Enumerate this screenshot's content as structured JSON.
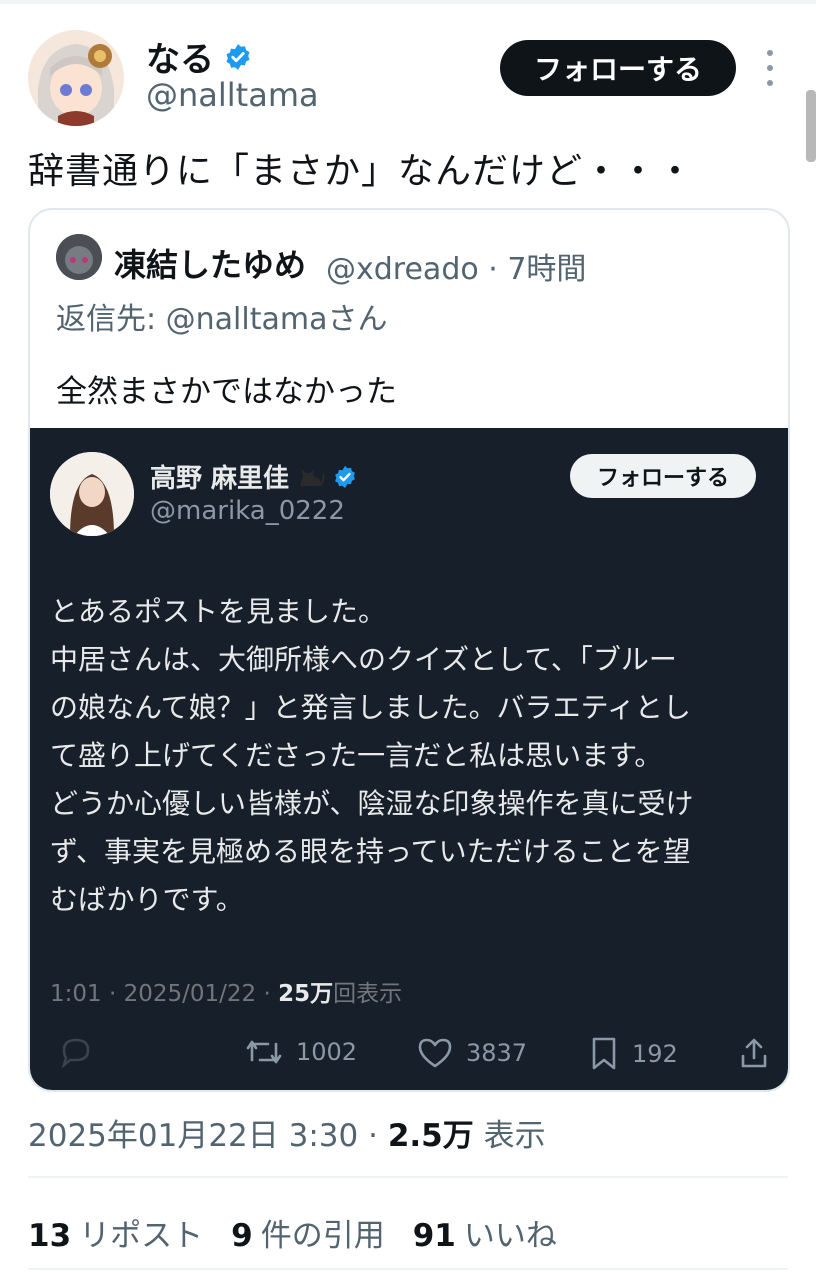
{
  "author": {
    "name": "なる",
    "handle": "@nalltama",
    "follow_label": "フォローする"
  },
  "tweet_text": "辞書通りに「まさか」なんだけど・・・",
  "quote": {
    "name": "凍結したゆめ",
    "meta": "@xdreado · 7時間",
    "reply_to": "返信先: @nalltamaさん",
    "text": "全然まさかではなかった"
  },
  "embed": {
    "name": "高野 麻里佳",
    "handle": "@marika_0222",
    "follow_label": "フォローする",
    "body_lines": [
      "とあるポストを見ました。",
      "中居さんは、大御所様へのクイズとして、「ブルー",
      "の娘なんて娘？」と発言しました。バラエティとし",
      "て盛り上げてくださった一言だと私は思います。",
      "どうか心優しい皆様が、陰湿な印象操作を真に受け",
      "ず、事実を見極める眼を持っていただけることを望",
      "むばかりです。"
    ],
    "time": "1:01 · 2025/01/22 · ",
    "views_count": "25万",
    "views_label": "回表示",
    "retweets": "1002",
    "likes": "3837",
    "bookmarks": "192"
  },
  "footer": {
    "datetime": "2025年01月22日 3:30 · ",
    "views_count": "2.5万",
    "views_label": " 表示",
    "reposts_count": "13",
    "reposts_label": "リポスト",
    "quotes_count": "9",
    "quotes_label": "件の引用",
    "likes_count": "91",
    "likes_label": "いいね"
  },
  "colors": {
    "verified": "#1d9bf0",
    "embed_bg": "#17202a",
    "follow_bg": "#0f1419"
  }
}
